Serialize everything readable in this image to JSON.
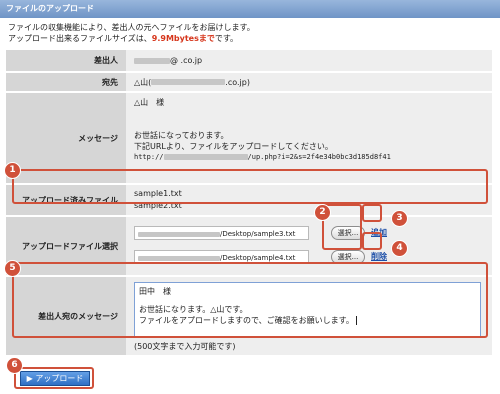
{
  "header": {
    "title": "ファイルのアップロード"
  },
  "intro": {
    "line1": "ファイルの収集機能により、差出人の元へファイルをお届けします。",
    "line2_prefix": "アップロード出来るファイルサイズは、",
    "line2_highlight": "9.9Mbytesまで",
    "line2_suffix": "です。"
  },
  "form": {
    "sender_label": "差出人",
    "sender_value_suffix": "@           .co.jp",
    "to_label": "宛先",
    "to_value_prefix": "△山(",
    "to_value_suffix": ".co.jp)",
    "message_label": "メッセージ",
    "message_lines": {
      "greet": "△山　様",
      "line1": "お世話になっております。",
      "line2": "下記URLより、ファイルをアップロードしてください。",
      "url_prefix": "http://",
      "url_suffix": "/up.php?i=2&s=2f4e34b0bc3d185d8f41"
    },
    "uploaded_label": "アップロード済みファイル",
    "uploaded_files": [
      "sample1.txt",
      "sample2.txt"
    ],
    "select_label": "アップロードファイル選択",
    "file_inputs": [
      {
        "path_suffix": "/Desktop/sample3.txt",
        "browse_label": "選択...",
        "action_label": "追加"
      },
      {
        "path_suffix": "/Desktop/sample4.txt",
        "browse_label": "選択...",
        "action_label": "削除"
      }
    ],
    "reply_label": "差出人宛のメッセージ",
    "reply_text": {
      "line1": "田中　様",
      "line2": "お世話になります。△山です。",
      "line3": "ファイルをアプロードしますので、ご確認をお願いします。"
    },
    "reply_hint": "(500文字まで入力可能です)"
  },
  "upload_button": "▶ アップロード",
  "callouts": [
    "1",
    "2",
    "3",
    "4",
    "5",
    "6"
  ],
  "colors": {
    "callout": "#d0513a",
    "header": "#7f9fcc",
    "highlight": "#d6351b",
    "link": "#1d4fa8"
  }
}
